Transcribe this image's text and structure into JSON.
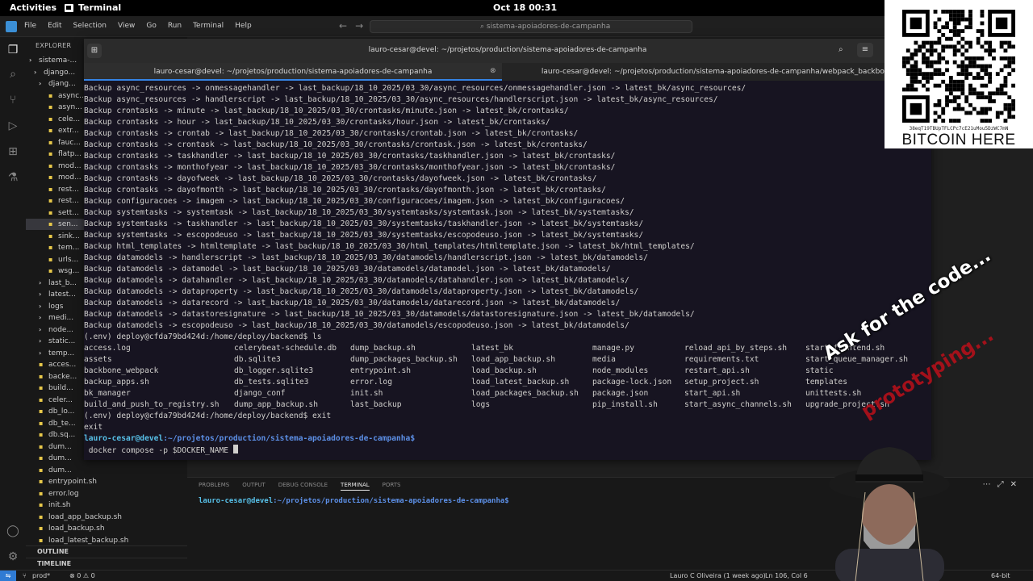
{
  "topbar": {
    "activities": "Activities",
    "app": "Terminal",
    "clock": "Oct 18  00:31"
  },
  "vscode": {
    "menu": [
      "File",
      "Edit",
      "Selection",
      "View",
      "Go",
      "Run",
      "Terminal",
      "Help"
    ],
    "search": "sistema-apoiadores-de-campanha",
    "explorer_title": "EXPLORER",
    "tree": [
      {
        "label": "sistema-...",
        "kind": "folder"
      },
      {
        "label": "django...",
        "kind": "folder"
      },
      {
        "label": "djang...",
        "kind": "folder"
      },
      {
        "label": "async...",
        "kind": "file"
      },
      {
        "label": "asyn...",
        "kind": "file"
      },
      {
        "label": "cele...",
        "kind": "file"
      },
      {
        "label": "extr...",
        "kind": "file"
      },
      {
        "label": "fauc...",
        "kind": "file"
      },
      {
        "label": "flatp...",
        "kind": "file"
      },
      {
        "label": "mod...",
        "kind": "file"
      },
      {
        "label": "mod...",
        "kind": "file"
      },
      {
        "label": "rest...",
        "kind": "file"
      },
      {
        "label": "rest...",
        "kind": "file"
      },
      {
        "label": "sett...",
        "kind": "file"
      },
      {
        "label": "sen...",
        "kind": "file"
      },
      {
        "label": "sink...",
        "kind": "file"
      },
      {
        "label": "tem...",
        "kind": "file"
      },
      {
        "label": "urls...",
        "kind": "file"
      },
      {
        "label": "wsg...",
        "kind": "file"
      },
      {
        "label": "last_b...",
        "kind": "folder"
      },
      {
        "label": "latest...",
        "kind": "folder"
      },
      {
        "label": "logs",
        "kind": "folder"
      },
      {
        "label": "medi...",
        "kind": "folder"
      },
      {
        "label": "node...",
        "kind": "folder"
      },
      {
        "label": "static...",
        "kind": "folder"
      },
      {
        "label": "temp...",
        "kind": "folder"
      },
      {
        "label": "acces...",
        "kind": "file"
      },
      {
        "label": "backe...",
        "kind": "file"
      },
      {
        "label": "build...",
        "kind": "file"
      },
      {
        "label": "celer...",
        "kind": "file"
      },
      {
        "label": "db_lo...",
        "kind": "file"
      },
      {
        "label": "db_te...",
        "kind": "file"
      },
      {
        "label": "db.sq...",
        "kind": "file"
      },
      {
        "label": "dum...",
        "kind": "file"
      },
      {
        "label": "dum...",
        "kind": "file"
      },
      {
        "label": "dum...",
        "kind": "file"
      },
      {
        "label": "entrypoint.sh",
        "kind": "file"
      },
      {
        "label": "error.log",
        "kind": "file"
      },
      {
        "label": "init.sh",
        "kind": "file"
      },
      {
        "label": "load_app_backup.sh",
        "kind": "file"
      },
      {
        "label": "load_backup.sh",
        "kind": "file"
      },
      {
        "label": "load_latest_backup.sh",
        "kind": "file"
      }
    ],
    "outline": "OUTLINE",
    "timeline": "TIMELINE",
    "panel_tabs": [
      "PROBLEMS",
      "OUTPUT",
      "DEBUG CONSOLE",
      "TERMINAL",
      "PORTS"
    ],
    "panel_prompt_user": "lauro-cesar@devel",
    "panel_prompt_path": ":~/projetos/production/sistema-apoiadores-de-campanha$",
    "status": {
      "branch": "prod*",
      "problems": "⊗ 0 ⚠ 0",
      "blame": "Lauro C Oliveira (1 week ago)",
      "position": "Ln 106, Col 6",
      "arch": "64-bit"
    }
  },
  "terminal": {
    "title": "lauro-cesar@devel: ~/projetos/production/sistema-apoiadores-de-campanha",
    "tabs": [
      {
        "label": "lauro-cesar@devel: ~/projetos/production/sistema-apoiadores-de-campanha",
        "active": true
      },
      {
        "label": "lauro-cesar@devel: ~/projetos/production/sistema-apoiadores-de-campanha/webpack_backbone",
        "active": false
      }
    ],
    "backup_lines": [
      "Backup async_resources -> onmessagehandler -> last_backup/18_10_2025/03_30/async_resources/onmessagehandler.json -> latest_bk/async_resources/",
      "Backup async_resources -> handlerscript -> last_backup/18_10_2025/03_30/async_resources/handlerscript.json -> latest_bk/async_resources/",
      "Backup crontasks -> minute -> last_backup/18_10_2025/03_30/crontasks/minute.json -> latest_bk/crontasks/",
      "Backup crontasks -> hour -> last_backup/18_10_2025/03_30/crontasks/hour.json -> latest_bk/crontasks/",
      "Backup crontasks -> crontab -> last_backup/18_10_2025/03_30/crontasks/crontab.json -> latest_bk/crontasks/",
      "Backup crontasks -> crontask -> last_backup/18_10_2025/03_30/crontasks/crontask.json -> latest_bk/crontasks/",
      "Backup crontasks -> taskhandler -> last_backup/18_10_2025/03_30/crontasks/taskhandler.json -> latest_bk/crontasks/",
      "Backup crontasks -> monthofyear -> last_backup/18_10_2025/03_30/crontasks/monthofyear.json -> latest_bk/crontasks/",
      "Backup crontasks -> dayofweek -> last_backup/18_10_2025/03_30/crontasks/dayofweek.json -> latest_bk/crontasks/",
      "Backup crontasks -> dayofmonth -> last_backup/18_10_2025/03_30/crontasks/dayofmonth.json -> latest_bk/crontasks/",
      "Backup configuracoes -> imagem -> last_backup/18_10_2025/03_30/configuracoes/imagem.json -> latest_bk/configuracoes/",
      "Backup systemtasks -> systemtask -> last_backup/18_10_2025/03_30/systemtasks/systemtask.json -> latest_bk/systemtasks/",
      "Backup systemtasks -> taskhandler -> last_backup/18_10_2025/03_30/systemtasks/taskhandler.json -> latest_bk/systemtasks/",
      "Backup systemtasks -> escopodeuso -> last_backup/18_10_2025/03_30/systemtasks/escopodeuso.json -> latest_bk/systemtasks/",
      "Backup html_templates -> htmltemplate -> last_backup/18_10_2025/03_30/html_templates/htmltemplate.json -> latest_bk/html_templates/",
      "Backup datamodels -> handlerscript -> last_backup/18_10_2025/03_30/datamodels/handlerscript.json -> latest_bk/datamodels/",
      "Backup datamodels -> datamodel -> last_backup/18_10_2025/03_30/datamodels/datamodel.json -> latest_bk/datamodels/",
      "Backup datamodels -> datahandler -> last_backup/18_10_2025/03_30/datamodels/datahandler.json -> latest_bk/datamodels/",
      "Backup datamodels -> dataproperty -> last_backup/18_10_2025/03_30/datamodels/dataproperty.json -> latest_bk/datamodels/",
      "Backup datamodels -> datarecord -> last_backup/18_10_2025/03_30/datamodels/datarecord.json -> latest_bk/datamodels/",
      "Backup datamodels -> datastoresignature -> last_backup/18_10_2025/03_30/datamodels/datastoresignature.json -> latest_bk/datamodels/",
      "Backup datamodels -> escopodeuso -> last_backup/18_10_2025/03_30/datamodels/escopodeuso.json -> latest_bk/datamodels/"
    ],
    "ls_command": "(.env) deploy@cfda79bd424d:/home/deploy/backend$ ls",
    "ls_rows": [
      [
        "access.log",
        "celerybeat-schedule.db",
        "dump_backup.sh",
        "latest_bk",
        "manage.py",
        "reload_api_by_steps.sh",
        "start_frontend.sh"
      ],
      [
        "assets",
        "db.sqlite3",
        "dump_packages_backup.sh",
        "load_app_backup.sh",
        "media",
        "requirements.txt",
        "start_queue_manager.sh"
      ],
      [
        "backbone_webpack",
        "db_logger.sqlite3",
        "entrypoint.sh",
        "load_backup.sh",
        "node_modules",
        "restart_api.sh",
        "static"
      ],
      [
        "backup_apps.sh",
        "db_tests.sqlite3",
        "error.log",
        "load_latest_backup.sh",
        "package-lock.json",
        "setup_project.sh",
        "templates"
      ],
      [
        "bk_manager",
        "django_conf",
        "init.sh",
        "load_packages_backup.sh",
        "package.json",
        "start_api.sh",
        "unittests.sh"
      ],
      [
        "build_and_push_to_registry.sh",
        "dump_app_backup.sh",
        "last_backup",
        "logs",
        "pip_install.sh",
        "start_async_channels.sh",
        "upgrade_project.sh"
      ]
    ],
    "exit_command": "(.env) deploy@cfda79bd424d:/home/deploy/backend$ exit",
    "exit_echo": "exit",
    "prompt_user": "lauro-cesar@devel",
    "prompt_path": ":~/projetos/production/sistema-apoiadores-de-campanha$",
    "current_command": " docker compose -p $DOCKER_NAME "
  },
  "overlay": {
    "btc_address": "38eqT19TBUpTFLCPc7cE21uMou5DzWC7mN",
    "btc_label": "BITCOIN HERE",
    "ask_text": "Ask for the code...",
    "proto_text": "prototyping..."
  }
}
